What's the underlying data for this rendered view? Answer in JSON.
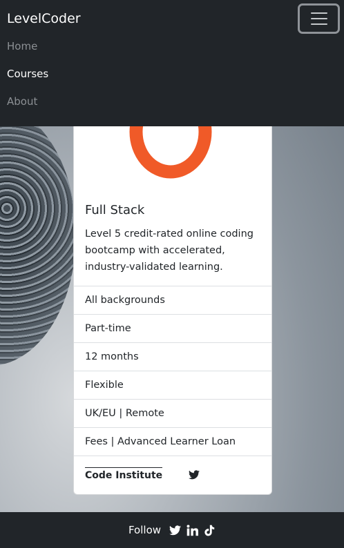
{
  "navbar": {
    "brand": "LevelCoder",
    "links": [
      {
        "label": "Home",
        "active": false
      },
      {
        "label": "Courses",
        "active": true
      },
      {
        "label": "About",
        "active": false
      }
    ],
    "toggler_icon": "hamburger-menu-icon"
  },
  "card": {
    "logo_color": "#f05a28",
    "title": "Full Stack",
    "description": "Level 5 credit-rated online coding bootcamp with accelerated, industry-validated learning.",
    "details": [
      "All backgrounds",
      "Part-time",
      "12 months",
      "Flexible",
      "UK/EU | Remote",
      "Fees | Advanced Learner Loan"
    ],
    "provider": "Code Institute",
    "provider_icon": "twitter-icon"
  },
  "footer": {
    "follow_label": "Follow",
    "icons": [
      "twitter-icon",
      "linkedin-icon",
      "tiktok-icon"
    ]
  },
  "colors": {
    "nav_bg": "#212529",
    "accent": "#f05a28"
  }
}
